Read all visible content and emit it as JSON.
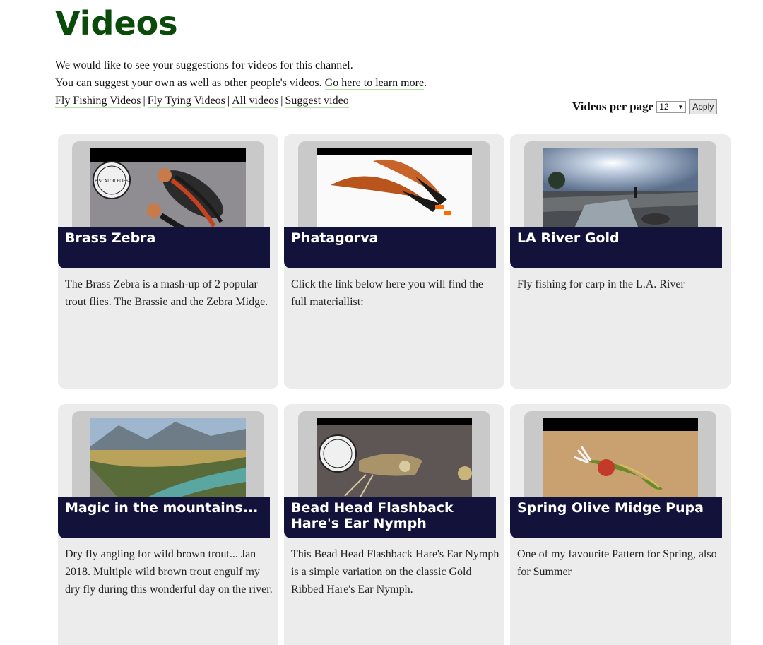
{
  "page": {
    "title": "Videos",
    "intro_line1": "We would like to see your suggestions for videos for this channel.",
    "intro_line2": "You can suggest your own as well as other people's videos.",
    "learn_more_link": "Go here to learn more",
    "learn_more_suffix": "."
  },
  "nav": {
    "links": [
      "Fly Fishing Videos",
      "Fly Tying Videos",
      "All videos",
      "Suggest video"
    ],
    "separator": "|"
  },
  "pager": {
    "label": "Videos per page",
    "selected": "12",
    "apply_label": "Apply"
  },
  "videos": [
    {
      "title": "Brass Zebra",
      "description": "The Brass Zebra is a mash-up of 2 popular trout flies. The Brassie and the Zebra Midge."
    },
    {
      "title": "Phatagorva",
      "description": "Click the link below here you will find the full materiallist:"
    },
    {
      "title": "LA River Gold",
      "description": "Fly fishing for carp in the L.A. River"
    },
    {
      "title": "Magic in the mountains...",
      "description": "Dry fly angling for wild brown trout... Jan 2018. Multiple wild brown trout engulf my dry fly during this wonderful day on the river."
    },
    {
      "title": "Bead Head Flashback Hare's Ear Nymph",
      "description": "This Bead Head Flashback Hare's Ear Nymph is a simple variation on the classic Gold Ribbed Hare's Ear Nymph."
    },
    {
      "title": "Spring Olive Midge Pupa",
      "description": "One of my favourite Pattern for Spring, also for Summer"
    }
  ],
  "thumbnail_logo_text": "PISCATOR FLIES",
  "colors": {
    "title_green": "#0a4a0a",
    "title_bar": "#12123a",
    "card_bg": "#ececec",
    "link_underline": "#b6e0a6"
  }
}
